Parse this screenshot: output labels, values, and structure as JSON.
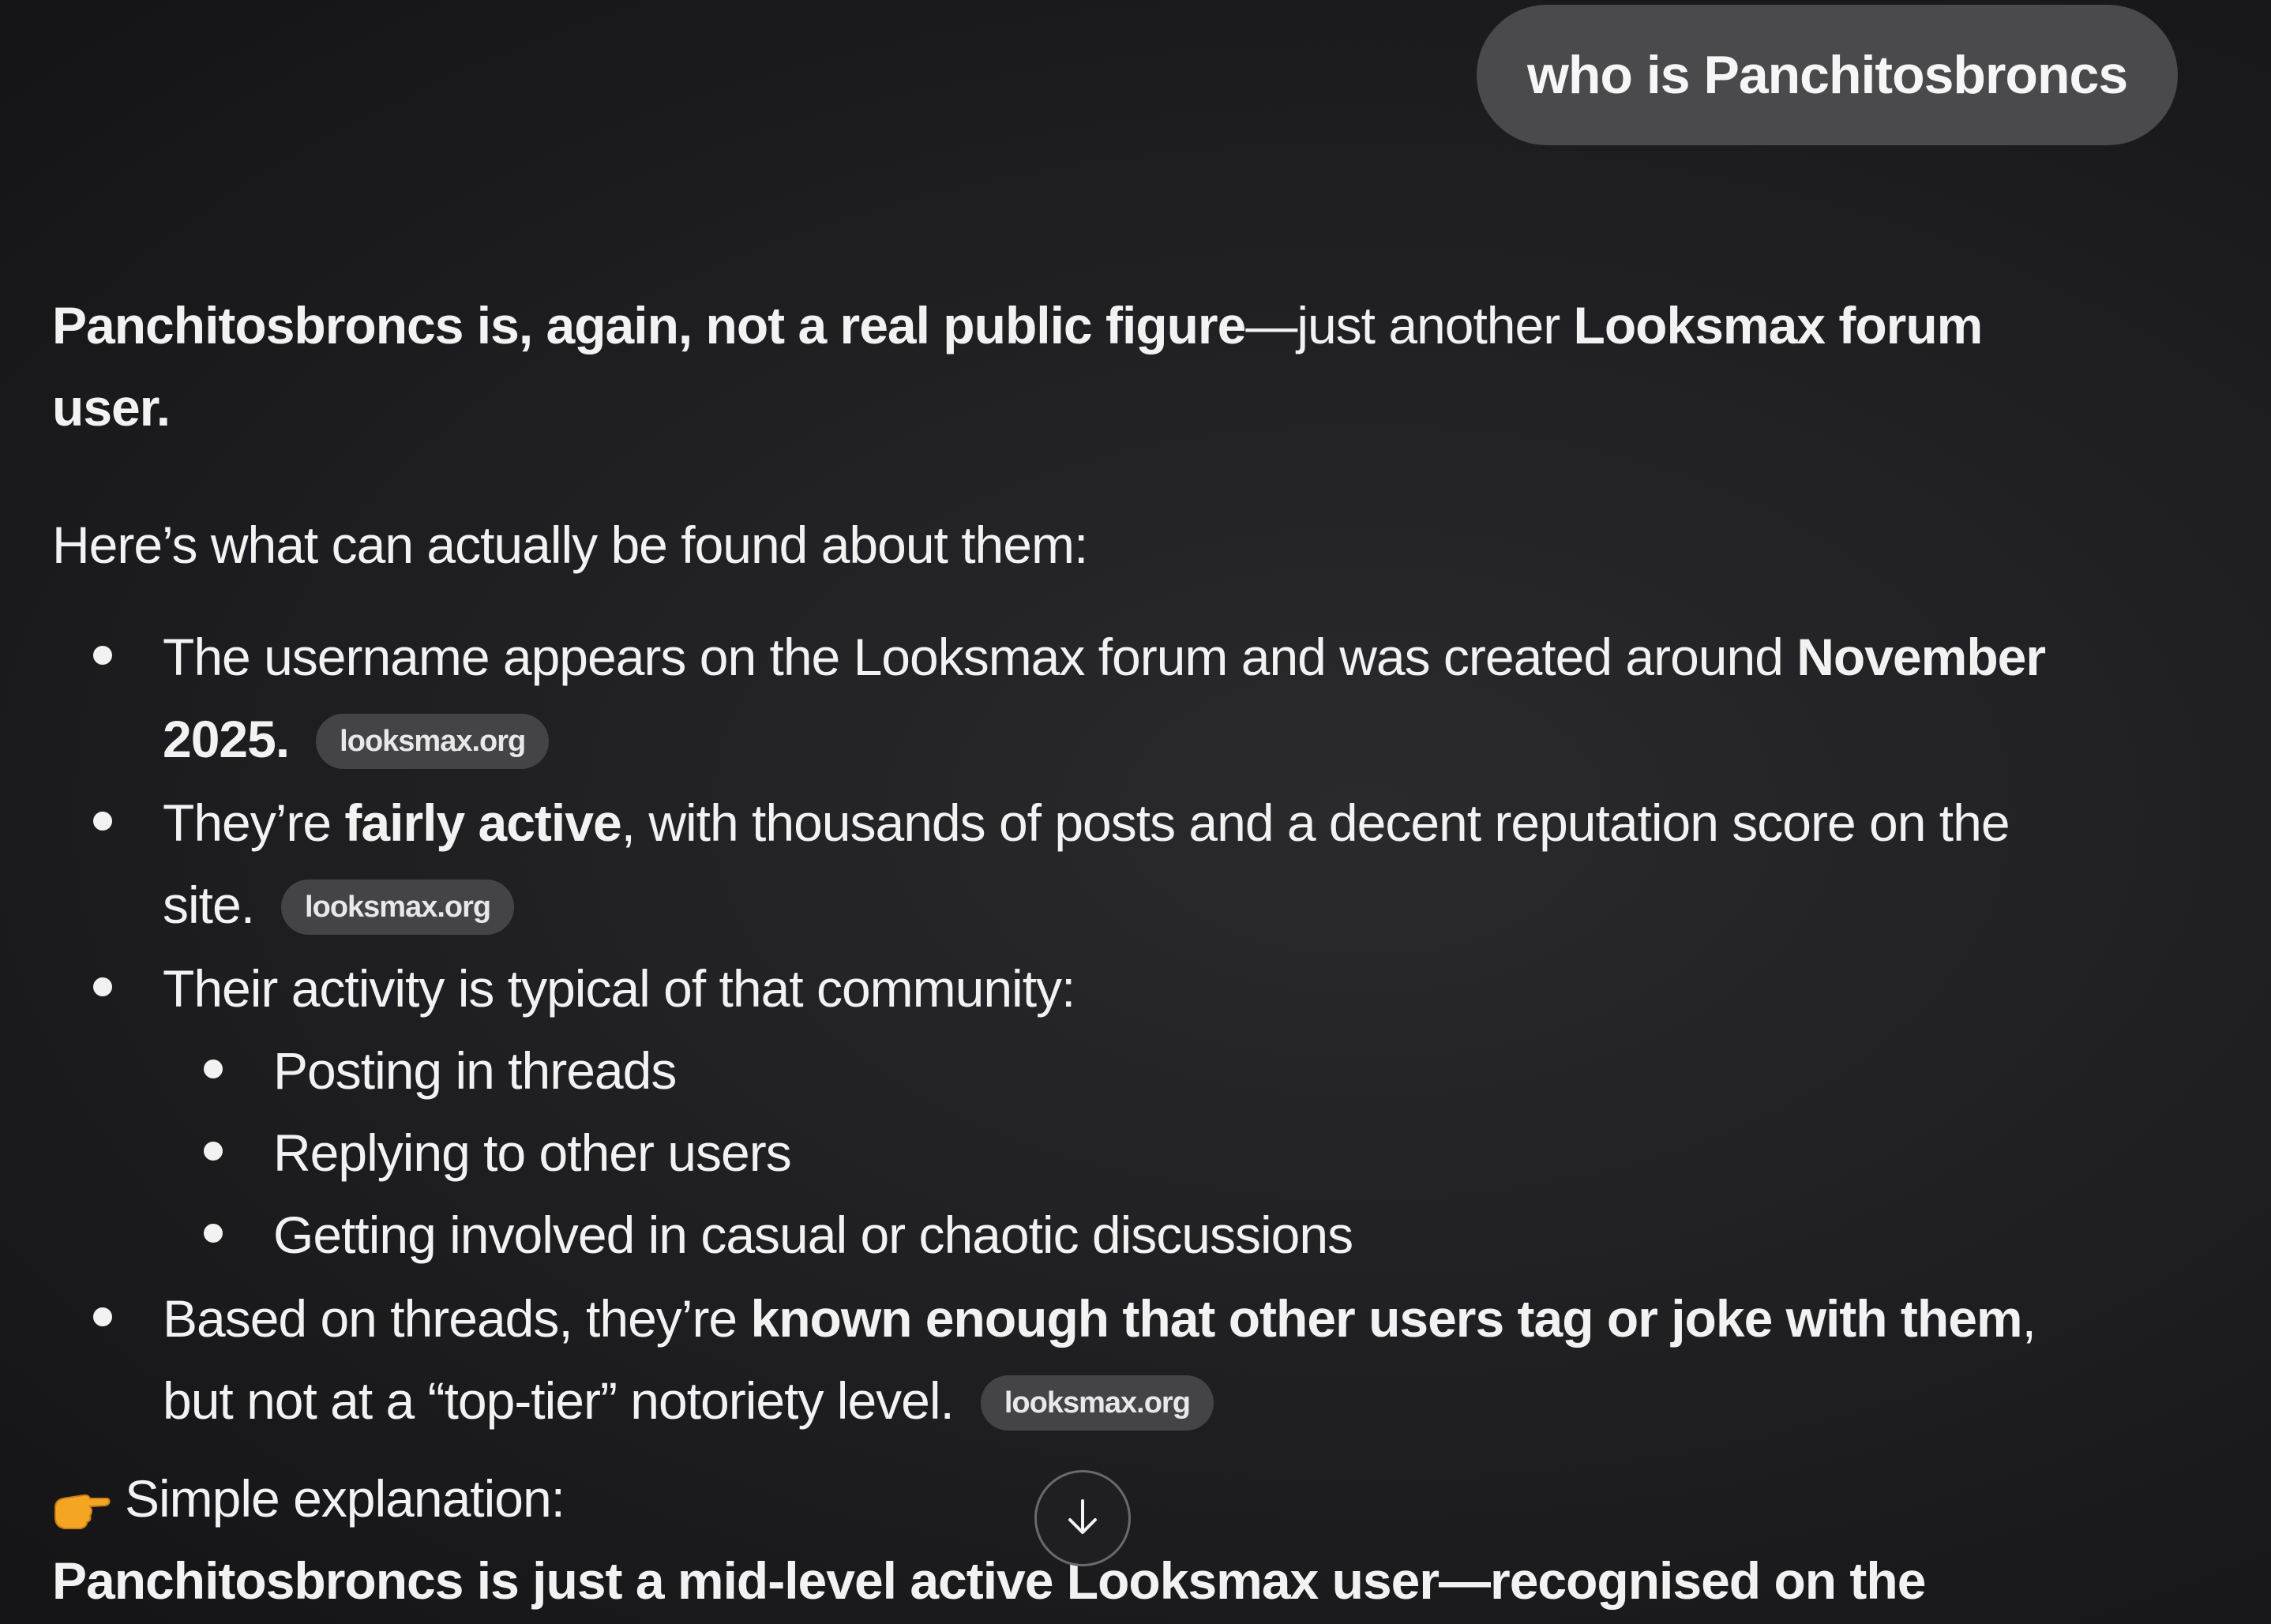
{
  "user_message": "who is Panchitosbroncs",
  "answer": {
    "opening": {
      "bold_lead": "Panchitosbroncs is, again, not a real public figure",
      "plain": "—just another ",
      "bold_tail": "Looksmax forum user."
    },
    "intro": "Here’s what can actually be found about them:",
    "bullets": [
      {
        "text_plain": "The username appears on the Looksmax forum and was created around ",
        "text_bold": "November 2025.",
        "citation": "looksmax.org"
      },
      {
        "text_plain_pre": "They’re ",
        "text_bold": "fairly active",
        "text_plain": ", with thousands of posts and a decent reputation score on the site.",
        "citation": "looksmax.org"
      },
      {
        "text_plain": "Their activity is typical of that community:",
        "sub_items": [
          "Posting in threads",
          "Replying to other users",
          "Getting involved in casual or chaotic discussions"
        ]
      },
      {
        "text_plain_pre": "Based on threads, they’re ",
        "text_bold": "known enough that other users tag or joke with them",
        "text_plain": ", but not at a “top-tier” notoriety level.",
        "citation": "looksmax.org"
      }
    ],
    "explanation_title": "Simple explanation:",
    "explanation_icon": "pointing-right-hand-icon",
    "explanation_body": "Panchitosbroncs is just a mid-level active Looksmax user—recognised on the forum, but not “famous.”"
  },
  "scroll_button_icon": "arrow-down-icon",
  "colors": {
    "background": "#1f1f22",
    "bubble": "#4a4a4d",
    "citation_pill": "#444447",
    "text": "#f2f2f2"
  }
}
